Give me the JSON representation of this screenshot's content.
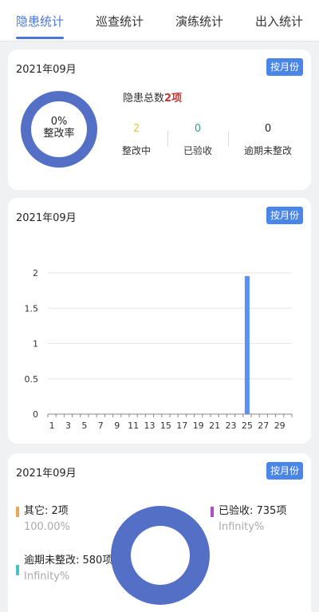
{
  "tabs": [
    {
      "label": "隐患统计",
      "active": true
    },
    {
      "label": "巡查统计",
      "active": false
    },
    {
      "label": "演练统计",
      "active": false
    },
    {
      "label": "出入统计",
      "active": false
    }
  ],
  "summary_card": {
    "date": "2021年09月",
    "month_button": "按月份",
    "rate_value": "0%",
    "rate_label": "整改率",
    "total_prefix": "隐患总数",
    "total_count": "2项",
    "stats": [
      {
        "value": "2",
        "label": "整改中",
        "color": "#e8c24d"
      },
      {
        "value": "0",
        "label": "已验收",
        "color": "#3a9e8a"
      },
      {
        "value": "0",
        "label": "逾期未整改",
        "color": "#222222"
      }
    ]
  },
  "daily_card": {
    "date": "2021年09月",
    "month_button": "按月份"
  },
  "chart_data": {
    "type": "bar",
    "x": [
      1,
      2,
      3,
      4,
      5,
      6,
      7,
      8,
      9,
      10,
      11,
      12,
      13,
      14,
      15,
      16,
      17,
      18,
      19,
      20,
      21,
      22,
      23,
      24,
      25,
      26,
      27,
      28,
      29,
      30
    ],
    "values": [
      0,
      0,
      0,
      0,
      0,
      0,
      0,
      0,
      0,
      0,
      0,
      0,
      0,
      0,
      0,
      0,
      0,
      0,
      0,
      0,
      0,
      0,
      0,
      0,
      2,
      0,
      0,
      0,
      0,
      0
    ],
    "x_tick_labels": [
      "1",
      "3",
      "5",
      "7",
      "9",
      "11",
      "13",
      "15",
      "17",
      "19",
      "21",
      "23",
      "25",
      "27",
      "29"
    ],
    "y_tick_labels": [
      "0",
      "0.5",
      "1",
      "1.5",
      "2"
    ],
    "ylim": [
      0,
      2
    ],
    "grid": true,
    "bar_color": "#5b8ff9"
  },
  "status_card": {
    "date": "2021年09月",
    "month_button": "按月份",
    "legend": [
      {
        "label": "其它: 2项",
        "pct": "100.00%",
        "color": "#e8a95a"
      },
      {
        "label": "已验收: 735项",
        "pct": "Infinity%",
        "color": "#b04cc4"
      },
      {
        "label": "逾期未整改: 580项",
        "pct": "Infinity%",
        "color": "#4ac2c0"
      }
    ]
  }
}
